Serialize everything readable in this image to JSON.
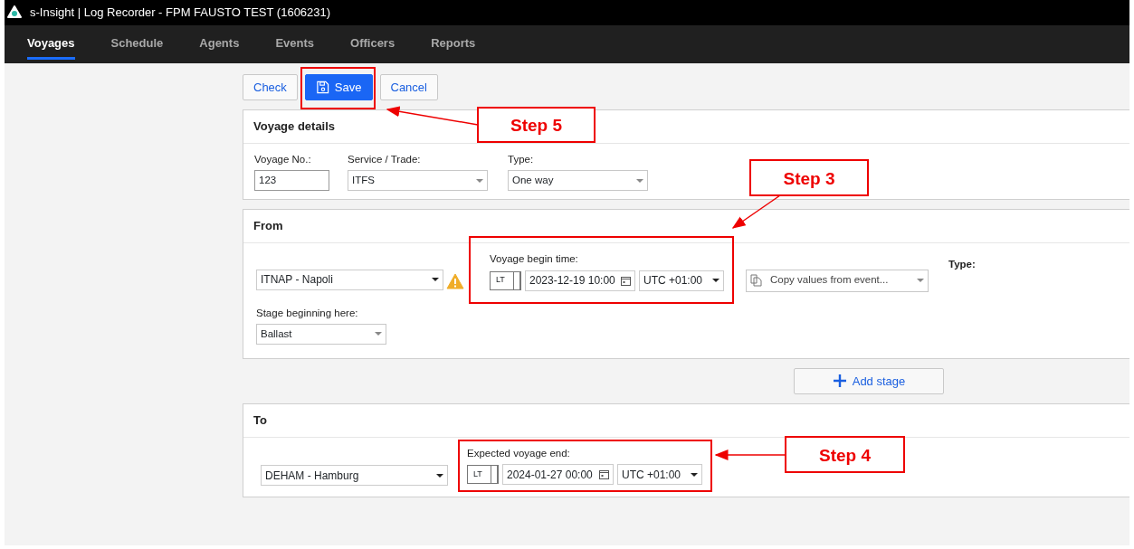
{
  "window": {
    "title": "s-Insight | Log Recorder - FPM FAUSTO TEST (1606231)"
  },
  "tabs": [
    {
      "label": "Voyages",
      "selected": true
    },
    {
      "label": "Schedule",
      "selected": false
    },
    {
      "label": "Agents",
      "selected": false
    },
    {
      "label": "Events",
      "selected": false
    },
    {
      "label": "Officers",
      "selected": false
    },
    {
      "label": "Reports",
      "selected": false
    }
  ],
  "toolbar": [
    {
      "label": "Check",
      "kind": "outline"
    },
    {
      "label": "Save",
      "kind": "primary"
    },
    {
      "label": "Cancel",
      "kind": "outline"
    }
  ],
  "voyage_details": {
    "title": "Voyage details",
    "fields": [
      {
        "label": "Voyage No.:",
        "value": "123",
        "kind": "text"
      },
      {
        "label": "Service / Trade:",
        "value": "ITFS",
        "kind": "select"
      },
      {
        "label": "Type:",
        "value": "One way",
        "kind": "select"
      }
    ]
  },
  "from": {
    "title": "From",
    "port": "ITNAP - Napoli",
    "warning": true,
    "time_label": "Voyage begin time:",
    "time_mode": "LT",
    "datetime": "2023-12-19 10:00",
    "timezone": "UTC +01:00",
    "copy_placeholder": "Copy values from event...",
    "type_label": "Type:",
    "stage_label": "Stage beginning here:",
    "stage_value": "Ballast"
  },
  "add_stage": {
    "label": "Add stage"
  },
  "to": {
    "title": "To",
    "port": "DEHAM - Hamburg",
    "time_label": "Expected voyage end:",
    "time_mode": "LT",
    "datetime": "2024-01-27 00:00",
    "timezone": "UTC +01:00"
  },
  "annotations": [
    {
      "label": "Step 5"
    },
    {
      "label": "Step 3"
    },
    {
      "label": "Step 4"
    }
  ]
}
